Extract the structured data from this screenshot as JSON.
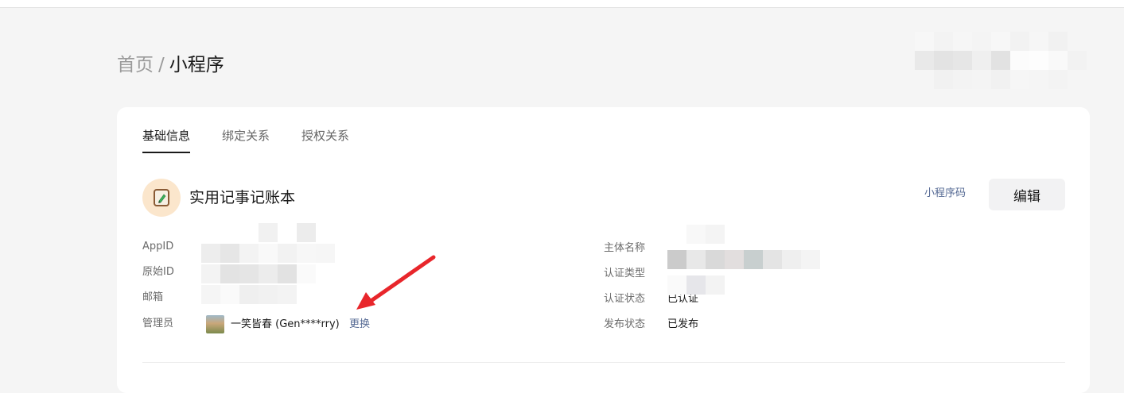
{
  "breadcrumb": {
    "home": "首页",
    "separator": "/",
    "current": "小程序"
  },
  "tabs": [
    {
      "label": "基础信息",
      "active": true
    },
    {
      "label": "绑定关系",
      "active": false
    },
    {
      "label": "授权关系",
      "active": false
    }
  ],
  "app": {
    "name": "实用记事记账本",
    "icon": "notepad-pencil-icon"
  },
  "actions": {
    "qrcode_label": "小程序码",
    "edit_label": "编辑"
  },
  "left_fields": {
    "appid_label": "AppID",
    "original_id_label": "原始ID",
    "email_label": "邮箱",
    "admin_label": "管理员",
    "admin_name": "一笑皆春 (Gen****rry)",
    "change_label": "更换"
  },
  "right_fields": {
    "entity_label": "主体名称",
    "cert_type_label": "认证类型",
    "cert_status_label": "认证状态",
    "cert_status_value": "已认证",
    "publish_status_label": "发布状态",
    "publish_status_value": "已发布"
  },
  "colors": {
    "link": "#576b95",
    "annotation_arrow": "#e8262b",
    "background": "#f5f5f5"
  }
}
